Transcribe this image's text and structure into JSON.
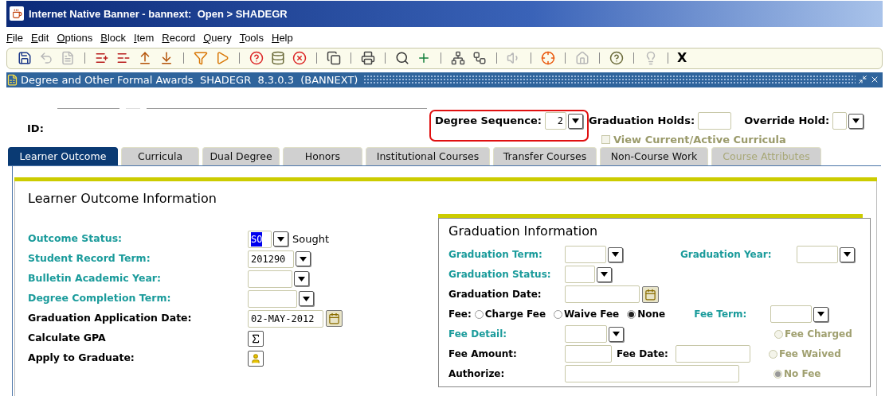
{
  "window": {
    "title": "Internet Native Banner - bannext:  Open > SHADEGR"
  },
  "menu": [
    {
      "label": "File"
    },
    {
      "label": "Edit"
    },
    {
      "label": "Options"
    },
    {
      "label": "Block"
    },
    {
      "label": "Item"
    },
    {
      "label": "Record"
    },
    {
      "label": "Query"
    },
    {
      "label": "Tools"
    },
    {
      "label": "Help"
    }
  ],
  "toolbar": {
    "groups": [
      [
        {
          "kind": "save",
          "disabled": false
        },
        {
          "kind": "undo",
          "disabled": true
        },
        {
          "kind": "document",
          "disabled": true
        }
      ],
      [
        {
          "kind": "insert",
          "disabled": false
        },
        {
          "kind": "remove",
          "disabled": false
        },
        {
          "kind": "up",
          "disabled": false
        },
        {
          "kind": "down",
          "disabled": false
        }
      ],
      [
        {
          "kind": "enter-query",
          "disabled": false
        },
        {
          "kind": "execute-query",
          "disabled": false
        }
      ],
      [
        {
          "kind": "help-db",
          "disabled": false
        },
        {
          "kind": "database",
          "disabled": false
        },
        {
          "kind": "cancel",
          "disabled": false
        }
      ],
      [
        {
          "kind": "copy",
          "disabled": false
        }
      ],
      [
        {
          "kind": "print",
          "disabled": false
        }
      ],
      [
        {
          "kind": "search",
          "disabled": false
        },
        {
          "kind": "add",
          "disabled": false
        }
      ],
      [
        {
          "kind": "network",
          "disabled": false
        },
        {
          "kind": "workflow",
          "disabled": false
        }
      ],
      [
        {
          "kind": "speaker",
          "disabled": true
        }
      ],
      [
        {
          "kind": "target",
          "disabled": false
        }
      ],
      [
        {
          "kind": "house",
          "disabled": true
        }
      ],
      [
        {
          "kind": "help",
          "disabled": false
        }
      ],
      [
        {
          "kind": "bulb",
          "disabled": true
        }
      ]
    ],
    "exit_label": "X"
  },
  "form": {
    "title": "Degree and Other Formal Awards  SHADEGR  8.3.0.3  (BANNEXT)"
  },
  "key_block": {
    "id_label": "ID:",
    "degree_sequence": {
      "label": "Degree Sequence:",
      "value": "2"
    },
    "graduation_holds": {
      "label": "Graduation Holds:"
    },
    "override_hold": {
      "label": "Override Hold:"
    },
    "view_curricula": {
      "label": "View Current/Active Curricula",
      "checked": false,
      "disabled": true
    }
  },
  "tabs": [
    {
      "label": "Learner Outcome",
      "selected": true,
      "disabled": false
    },
    {
      "label": "Curricula",
      "selected": false,
      "disabled": false
    },
    {
      "label": "Dual Degree",
      "selected": false,
      "disabled": false
    },
    {
      "label": "Honors",
      "selected": false,
      "disabled": false
    },
    {
      "label": "Institutional Courses",
      "selected": false,
      "disabled": false
    },
    {
      "label": "Transfer Courses",
      "selected": false,
      "disabled": false
    },
    {
      "label": "Non-Course Work",
      "selected": false,
      "disabled": false
    },
    {
      "label": "Course Attributes",
      "selected": false,
      "disabled": true
    }
  ],
  "learner_outcome": {
    "title": "Learner Outcome Information",
    "fields": [
      {
        "label": "Outcome Status:",
        "kind": "select",
        "value": "SO",
        "value_selected": true,
        "description": "Sought"
      },
      {
        "label": "Student Record Term:",
        "kind": "select",
        "value": "201290",
        "value_selected": false
      },
      {
        "label": "Bulletin Academic Year:",
        "kind": "select"
      },
      {
        "label": "Degree Completion Term:",
        "kind": "select"
      },
      {
        "label": "Graduation Application Date:",
        "kind": "date",
        "value": "02-MAY-2012",
        "value_selected": false
      },
      {
        "label": "Calculate GPA",
        "kind": "sum"
      },
      {
        "label": "Apply to Graduate:",
        "kind": "person"
      }
    ]
  },
  "graduation": {
    "title": "Graduation Information",
    "term": {
      "label": "Graduation Term:",
      "kind": "select"
    },
    "year": {
      "label": "Graduation Year:",
      "kind": "select"
    },
    "status": {
      "label": "Graduation Status:",
      "kind": "select"
    },
    "date": {
      "label": "Graduation Date:",
      "kind": "date"
    },
    "fee": {
      "label": "Fee:",
      "options": [
        {
          "label": "Charge Fee",
          "selected": false
        },
        {
          "label": "Waive Fee",
          "selected": false
        },
        {
          "label": "None",
          "selected": true
        }
      ]
    },
    "fee_term": {
      "label": "Fee Term:",
      "kind": "select"
    },
    "fee_detail": {
      "label": "Fee Detail:",
      "kind": "select"
    },
    "fee_amount": {
      "label": "Fee Amount:",
      "kind": "text"
    },
    "fee_date": {
      "label": "Fee Date:",
      "kind": "text"
    },
    "authorize": {
      "label": "Authorize:",
      "kind": "text"
    },
    "fee_state": {
      "disabled": true,
      "options": [
        {
          "label": "Fee Charged",
          "selected": false
        },
        {
          "label": "Fee Waived",
          "selected": false
        },
        {
          "label": "No Fee",
          "selected": true
        }
      ]
    }
  }
}
